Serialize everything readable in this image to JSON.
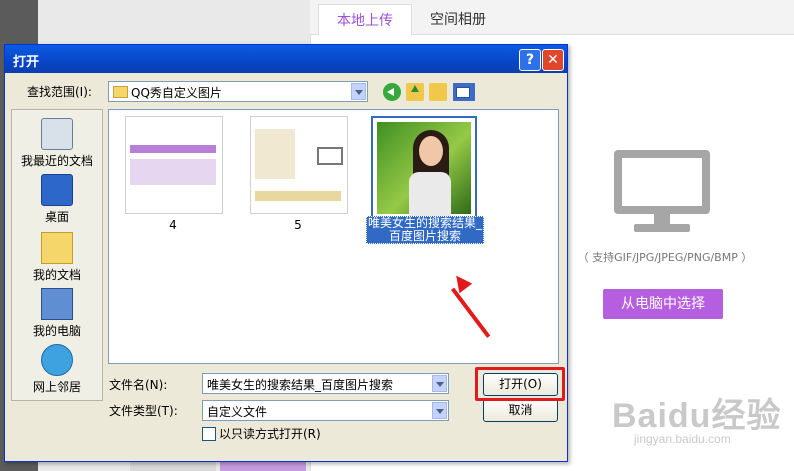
{
  "background": {
    "tabs": [
      "本地上传",
      "空间相册"
    ],
    "formats_text": "（ 支持GIF/JPG/JPEG/PNG/BMP ）",
    "pick_button": "从电脑中选择",
    "watermark": "Baidu经验",
    "watermark_sub": "jingyan.baidu.com"
  },
  "dialog": {
    "title": "打开",
    "help": "?",
    "close": "✕",
    "look_in_label": "查找范围(I):",
    "look_in_value": "QQ秀自定义图片",
    "places": [
      "我最近的文档",
      "桌面",
      "我的文档",
      "我的电脑",
      "网上邻居"
    ],
    "files": [
      {
        "name": "4"
      },
      {
        "name": "5"
      },
      {
        "name": "唯美女生的搜索结果_百度图片搜索"
      }
    ],
    "filename_label": "文件名(N):",
    "filename_value": "唯美女生的搜索结果_百度图片搜索",
    "filetype_label": "文件类型(T):",
    "filetype_value": "自定义文件",
    "readonly_label": "以只读方式打开(R)",
    "open_button": "打开(O)",
    "cancel_button": "取消"
  }
}
